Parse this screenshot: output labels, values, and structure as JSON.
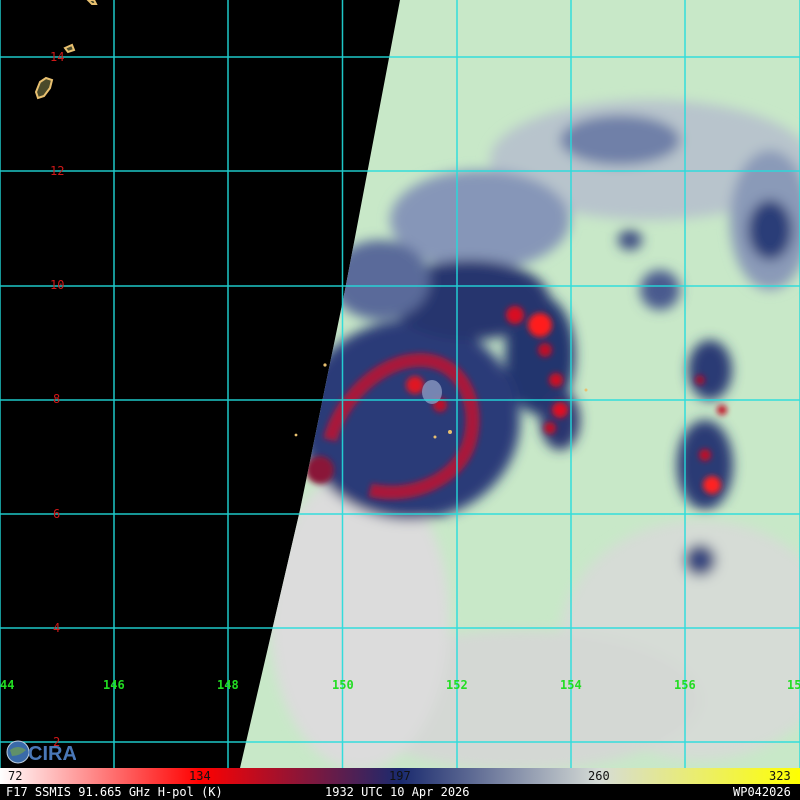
{
  "map": {
    "latitude_labels": [
      "14",
      "12",
      "10",
      "8",
      "6",
      "4",
      "2"
    ],
    "longitude_labels": [
      "44",
      "146",
      "148",
      "150",
      "152",
      "154",
      "156",
      "15"
    ],
    "gridline_color": "#22dddd",
    "lat_label_color": "#d01818",
    "lon_label_color": "#22dd22",
    "land_outline_color": "#e8c070",
    "no_data_color": "#000000"
  },
  "colorbar": {
    "ticks": [
      "72",
      "134",
      "197",
      "260",
      "323"
    ],
    "colors": [
      "#ffffff",
      "#ff0000",
      "#1a2a6e",
      "#d6dcd6",
      "#ffff00"
    ]
  },
  "footer": {
    "sensor": "F17 SSMIS 91.665 GHz H-pol (K)",
    "datetime": "1932 UTC 10 Apr 2026",
    "storm_id": "WP042026"
  },
  "logo": {
    "text": "CIRA",
    "icon": "cira-globe-icon"
  }
}
